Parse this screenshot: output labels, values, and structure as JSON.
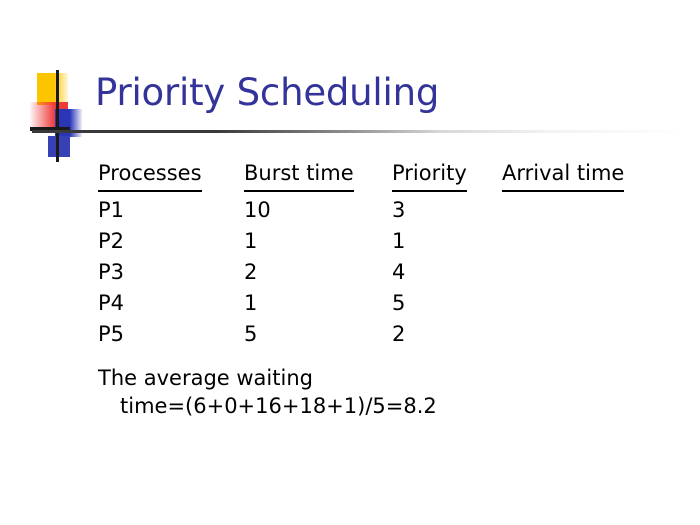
{
  "slide": {
    "title": "Priority Scheduling",
    "title_color": "#333399",
    "background_color": "#ffffff",
    "decoration": {
      "name": "powerpoint-design-accent",
      "colors": {
        "yellow": "#fdc400",
        "red": "#ef3a3a",
        "blue": "#2b35b8",
        "line": "#1a1a1a"
      }
    }
  },
  "table": {
    "headers": [
      "Processes",
      "Burst time",
      "Priority",
      "Arrival time"
    ],
    "rows": [
      {
        "process": "P1",
        "burst_time": "10",
        "priority": "3",
        "arrival_time": ""
      },
      {
        "process": "P2",
        "burst_time": "1",
        "priority": "1",
        "arrival_time": ""
      },
      {
        "process": "P3",
        "burst_time": "2",
        "priority": "4",
        "arrival_time": ""
      },
      {
        "process": "P4",
        "burst_time": "1",
        "priority": "5",
        "arrival_time": ""
      },
      {
        "process": "P5",
        "burst_time": "5",
        "priority": "2",
        "arrival_time": ""
      }
    ]
  },
  "summary": {
    "line1": "The average waiting",
    "line2": "time=(6+0+16+18+1)/5=8.2"
  }
}
